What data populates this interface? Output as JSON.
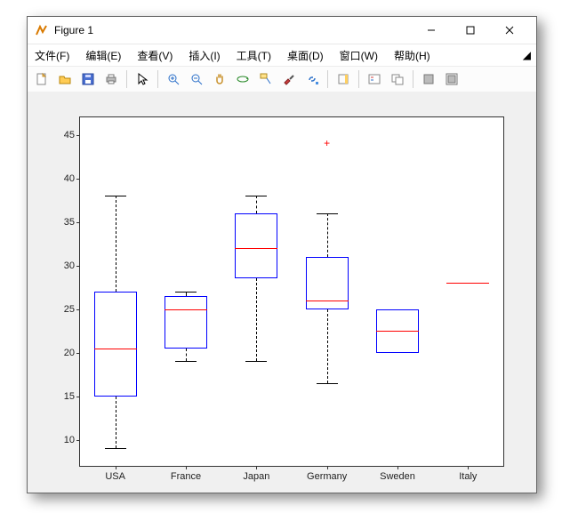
{
  "window": {
    "title": "Figure 1",
    "menus": [
      "文件(F)",
      "编辑(E)",
      "查看(V)",
      "插入(I)",
      "工具(T)",
      "桌面(D)",
      "窗口(W)",
      "帮助(H)"
    ],
    "toolbar_icons": [
      "new-file-icon",
      "open-file-icon",
      "save-icon",
      "print-icon",
      "sep",
      "pointer-icon",
      "sep",
      "zoom-in-icon",
      "zoom-out-icon",
      "pan-icon",
      "rotate-3d-icon",
      "data-cursor-icon",
      "brush-icon",
      "colorbar-icon",
      "sep",
      "link-axes-icon",
      "sep",
      "insert-legend-icon",
      "insert-colorbar-icon",
      "sep",
      "hide-tools-icon",
      "show-tools-icon"
    ]
  },
  "chart_data": {
    "type": "box",
    "categories": [
      "USA",
      "France",
      "Japan",
      "Germany",
      "Sweden",
      "Italy"
    ],
    "ylim": [
      7,
      47
    ],
    "yticks": [
      10,
      15,
      20,
      25,
      30,
      35,
      40,
      45
    ],
    "series": [
      {
        "name": "USA",
        "q1": 15,
        "median": 20.5,
        "q3": 27,
        "whisker_low": 9,
        "whisker_high": 38,
        "outliers": []
      },
      {
        "name": "France",
        "q1": 20.5,
        "median": 25,
        "q3": 26.5,
        "whisker_low": 19,
        "whisker_high": 27,
        "outliers": []
      },
      {
        "name": "Japan",
        "q1": 28.5,
        "median": 32,
        "q3": 36,
        "whisker_low": 19,
        "whisker_high": 38,
        "outliers": []
      },
      {
        "name": "Germany",
        "q1": 25,
        "median": 26,
        "q3": 31,
        "whisker_low": 16.5,
        "whisker_high": 36,
        "outliers": [
          44
        ]
      },
      {
        "name": "Sweden",
        "q1": 20,
        "median": 22.5,
        "q3": 25,
        "whisker_low": 20,
        "whisker_high": 25,
        "outliers": []
      },
      {
        "name": "Italy",
        "q1": 28,
        "median": 28,
        "q3": 28,
        "whisker_low": 28,
        "whisker_high": 28,
        "outliers": []
      }
    ]
  }
}
